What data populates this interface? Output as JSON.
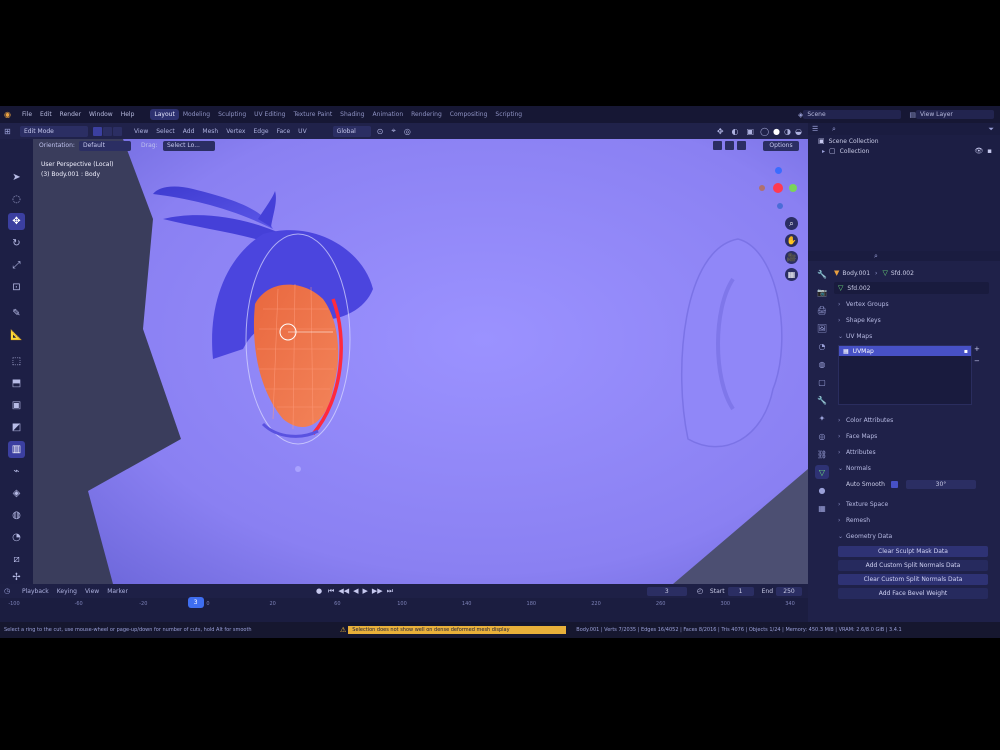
{
  "menubar": {
    "items": [
      "File",
      "Edit",
      "Render",
      "Window",
      "Help"
    ],
    "workspaces": [
      "Layout",
      "Modeling",
      "Sculpting",
      "UV Editing",
      "Texture Paint",
      "Shading",
      "Animation",
      "Rendering",
      "Compositing",
      "Scripting"
    ],
    "active_workspace": "Layout",
    "scene_label": "Scene",
    "view_layer_label": "View Layer"
  },
  "header": {
    "mode": "Edit Mode",
    "menus": [
      "View",
      "Select",
      "Add",
      "Mesh",
      "Vertex",
      "Edge",
      "Face",
      "UV"
    ],
    "transform_orientation": "Global",
    "options_label": "Options"
  },
  "viewport": {
    "orientation_label": "Orientation:",
    "orientation_value": "Default",
    "drag_label": "Drag:",
    "drag_value": "Select Lo...",
    "overlay_line1": "User Perspective (Local)",
    "overlay_line2": "(3) Body.001 : Body"
  },
  "outliner": {
    "collection_label": "Scene Collection",
    "item_label": "Collection"
  },
  "properties": {
    "object_name": "Body.001",
    "mesh_name": "Sfd.002",
    "data_name": "Sfd.002",
    "sections": [
      "Vertex Groups",
      "Shape Keys",
      "UV Maps"
    ],
    "uv_map_item": "UVMap",
    "lower_sections": [
      "Color Attributes",
      "Face Maps",
      "Attributes",
      "Normals"
    ],
    "auto_smooth_label": "Auto Smooth",
    "auto_smooth_value": "30°",
    "more_sections": [
      "Texture Space",
      "Remesh",
      "Geometry Data"
    ],
    "buttons": [
      "Clear Sculpt Mask Data",
      "Add Custom Split Normals Data",
      "Clear Custom Split Normals Data",
      "Add Face Bevel Weight"
    ]
  },
  "timeline": {
    "menus": [
      "Playback",
      "Keying",
      "View",
      "Marker"
    ],
    "current_frame": "3",
    "start_label": "Start",
    "start_value": "1",
    "end_label": "End",
    "end_value": "250",
    "ticks": [
      "-100",
      "-60",
      "-20",
      "0",
      "20",
      "60",
      "100",
      "140",
      "180",
      "220",
      "260",
      "300",
      "340"
    ],
    "playhead_frame": 3
  },
  "statusbar": {
    "left": "Select a ring to the cut, use mouse-wheel or page-up/down for number of cuts, hold Alt for smooth",
    "warning": "Selection does not show well on dense deformed mesh display",
    "right": "Body.001 | Verts 7/2035 | Edges 16/4052 | Faces 8/2016 | Tris 4076 | Objects 1/24 | Memory: 450.3 MiB | VRAM: 2.6/8.0 GiB | 3.4.1"
  },
  "colors": {
    "accent": "#3b3fa0",
    "viewport_bg": "#5e5ec9",
    "skin": "#8f86f5",
    "eye_orange": "#f07048",
    "selection_red": "#ff2a3c"
  }
}
